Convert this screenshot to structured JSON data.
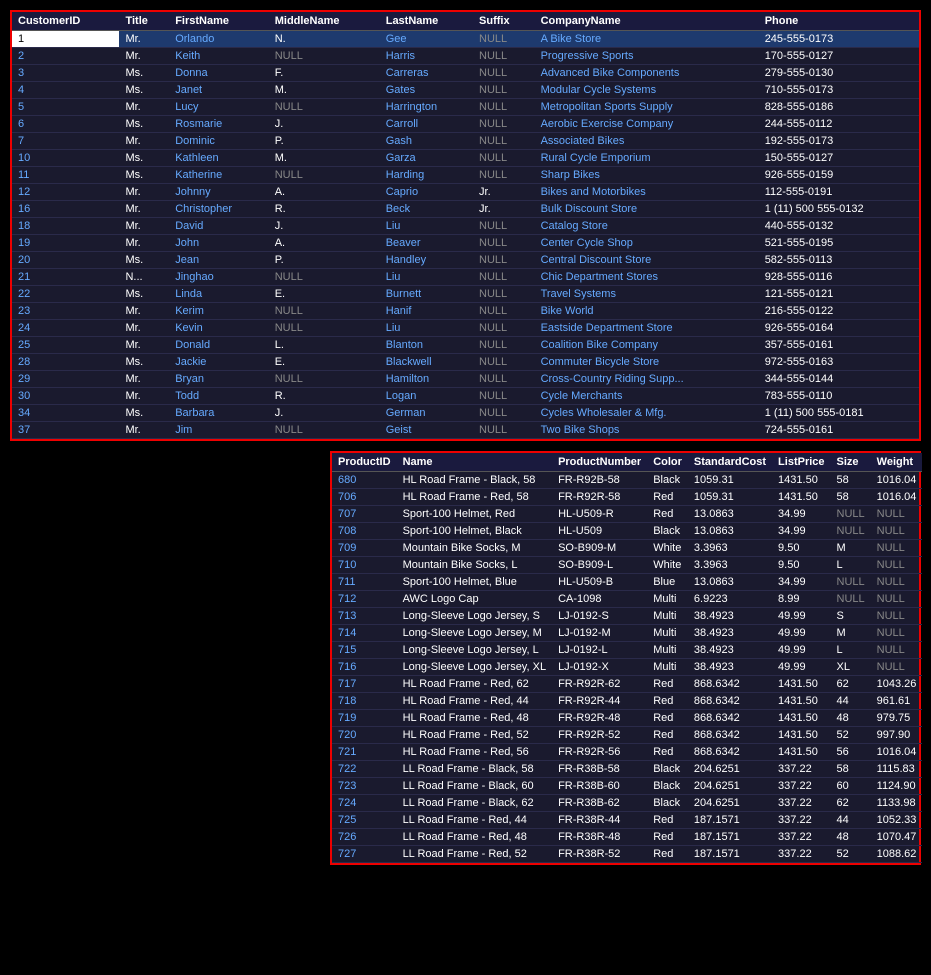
{
  "table1": {
    "columns": [
      "CustomerID",
      "Title",
      "FirstName",
      "MiddleName",
      "LastName",
      "Suffix",
      "CompanyName",
      "Phone"
    ],
    "rows": [
      {
        "id": "1",
        "title": "Mr.",
        "firstName": "Orlando",
        "middleName": "N.",
        "lastName": "Gee",
        "suffix": "NULL",
        "company": "A Bike Store",
        "phone": "245-555-0173",
        "selected": true
      },
      {
        "id": "2",
        "title": "Mr.",
        "firstName": "Keith",
        "middleName": "NULL",
        "lastName": "Harris",
        "suffix": "NULL",
        "company": "Progressive Sports",
        "phone": "170-555-0127"
      },
      {
        "id": "3",
        "title": "Ms.",
        "firstName": "Donna",
        "middleName": "F.",
        "lastName": "Carreras",
        "suffix": "NULL",
        "company": "Advanced Bike Components",
        "phone": "279-555-0130"
      },
      {
        "id": "4",
        "title": "Ms.",
        "firstName": "Janet",
        "middleName": "M.",
        "lastName": "Gates",
        "suffix": "NULL",
        "company": "Modular Cycle Systems",
        "phone": "710-555-0173"
      },
      {
        "id": "5",
        "title": "Mr.",
        "firstName": "Lucy",
        "middleName": "NULL",
        "lastName": "Harrington",
        "suffix": "NULL",
        "company": "Metropolitan Sports Supply",
        "phone": "828-555-0186"
      },
      {
        "id": "6",
        "title": "Ms.",
        "firstName": "Rosmarie",
        "middleName": "J.",
        "lastName": "Carroll",
        "suffix": "NULL",
        "company": "Aerobic Exercise Company",
        "phone": "244-555-0112"
      },
      {
        "id": "7",
        "title": "Mr.",
        "firstName": "Dominic",
        "middleName": "P.",
        "lastName": "Gash",
        "suffix": "NULL",
        "company": "Associated Bikes",
        "phone": "192-555-0173"
      },
      {
        "id": "10",
        "title": "Ms.",
        "firstName": "Kathleen",
        "middleName": "M.",
        "lastName": "Garza",
        "suffix": "NULL",
        "company": "Rural Cycle Emporium",
        "phone": "150-555-0127"
      },
      {
        "id": "11",
        "title": "Ms.",
        "firstName": "Katherine",
        "middleName": "NULL",
        "lastName": "Harding",
        "suffix": "NULL",
        "company": "Sharp Bikes",
        "phone": "926-555-0159"
      },
      {
        "id": "12",
        "title": "Mr.",
        "firstName": "Johnny",
        "middleName": "A.",
        "lastName": "Caprio",
        "suffix": "Jr.",
        "company": "Bikes and Motorbikes",
        "phone": "112-555-0191"
      },
      {
        "id": "16",
        "title": "Mr.",
        "firstName": "Christopher",
        "middleName": "R.",
        "lastName": "Beck",
        "suffix": "Jr.",
        "company": "Bulk Discount Store",
        "phone": "1 (11) 500 555-0132"
      },
      {
        "id": "18",
        "title": "Mr.",
        "firstName": "David",
        "middleName": "J.",
        "lastName": "Liu",
        "suffix": "NULL",
        "company": "Catalog Store",
        "phone": "440-555-0132"
      },
      {
        "id": "19",
        "title": "Mr.",
        "firstName": "John",
        "middleName": "A.",
        "lastName": "Beaver",
        "suffix": "NULL",
        "company": "Center Cycle Shop",
        "phone": "521-555-0195"
      },
      {
        "id": "20",
        "title": "Ms.",
        "firstName": "Jean",
        "middleName": "P.",
        "lastName": "Handley",
        "suffix": "NULL",
        "company": "Central Discount Store",
        "phone": "582-555-0113"
      },
      {
        "id": "21",
        "title": "N...",
        "firstName": "Jinghao",
        "middleName": "NULL",
        "lastName": "Liu",
        "suffix": "NULL",
        "company": "Chic Department Stores",
        "phone": "928-555-0116"
      },
      {
        "id": "22",
        "title": "Ms.",
        "firstName": "Linda",
        "middleName": "E.",
        "lastName": "Burnett",
        "suffix": "NULL",
        "company": "Travel Systems",
        "phone": "121-555-0121"
      },
      {
        "id": "23",
        "title": "Mr.",
        "firstName": "Kerim",
        "middleName": "NULL",
        "lastName": "Hanif",
        "suffix": "NULL",
        "company": "Bike World",
        "phone": "216-555-0122"
      },
      {
        "id": "24",
        "title": "Mr.",
        "firstName": "Kevin",
        "middleName": "NULL",
        "lastName": "Liu",
        "suffix": "NULL",
        "company": "Eastside Department Store",
        "phone": "926-555-0164"
      },
      {
        "id": "25",
        "title": "Mr.",
        "firstName": "Donald",
        "middleName": "L.",
        "lastName": "Blanton",
        "suffix": "NULL",
        "company": "Coalition Bike Company",
        "phone": "357-555-0161"
      },
      {
        "id": "28",
        "title": "Ms.",
        "firstName": "Jackie",
        "middleName": "E.",
        "lastName": "Blackwell",
        "suffix": "NULL",
        "company": "Commuter Bicycle Store",
        "phone": "972-555-0163"
      },
      {
        "id": "29",
        "title": "Mr.",
        "firstName": "Bryan",
        "middleName": "NULL",
        "lastName": "Hamilton",
        "suffix": "NULL",
        "company": "Cross-Country Riding Supp...",
        "phone": "344-555-0144"
      },
      {
        "id": "30",
        "title": "Mr.",
        "firstName": "Todd",
        "middleName": "R.",
        "lastName": "Logan",
        "suffix": "NULL",
        "company": "Cycle Merchants",
        "phone": "783-555-0110"
      },
      {
        "id": "34",
        "title": "Ms.",
        "firstName": "Barbara",
        "middleName": "J.",
        "lastName": "German",
        "suffix": "NULL",
        "company": "Cycles Wholesaler & Mfg.",
        "phone": "1 (11) 500 555-0181"
      },
      {
        "id": "37",
        "title": "Mr.",
        "firstName": "Jim",
        "middleName": "NULL",
        "lastName": "Geist",
        "suffix": "NULL",
        "company": "Two Bike Shops",
        "phone": "724-555-0161"
      }
    ]
  },
  "table2": {
    "columns": [
      "ProductID",
      "Name",
      "ProductNumber",
      "Color",
      "StandardCost",
      "ListPrice",
      "Size",
      "Weight"
    ],
    "rows": [
      {
        "id": "680",
        "name": "HL Road Frame - Black, 58",
        "productNumber": "FR-R92B-58",
        "color": "Black",
        "standardCost": "1059.31",
        "listPrice": "1431.50",
        "size": "58",
        "weight": "1016.04"
      },
      {
        "id": "706",
        "name": "HL Road Frame - Red, 58",
        "productNumber": "FR-R92R-58",
        "color": "Red",
        "standardCost": "1059.31",
        "listPrice": "1431.50",
        "size": "58",
        "weight": "1016.04"
      },
      {
        "id": "707",
        "name": "Sport-100 Helmet, Red",
        "productNumber": "HL-U509-R",
        "color": "Red",
        "standardCost": "13.0863",
        "listPrice": "34.99",
        "size": "NULL",
        "weight": "NULL"
      },
      {
        "id": "708",
        "name": "Sport-100 Helmet, Black",
        "productNumber": "HL-U509",
        "color": "Black",
        "standardCost": "13.0863",
        "listPrice": "34.99",
        "size": "NULL",
        "weight": "NULL"
      },
      {
        "id": "709",
        "name": "Mountain Bike Socks, M",
        "productNumber": "SO-B909-M",
        "color": "White",
        "standardCost": "3.3963",
        "listPrice": "9.50",
        "size": "M",
        "weight": "NULL"
      },
      {
        "id": "710",
        "name": "Mountain Bike Socks, L",
        "productNumber": "SO-B909-L",
        "color": "White",
        "standardCost": "3.3963",
        "listPrice": "9.50",
        "size": "L",
        "weight": "NULL"
      },
      {
        "id": "711",
        "name": "Sport-100 Helmet, Blue",
        "productNumber": "HL-U509-B",
        "color": "Blue",
        "standardCost": "13.0863",
        "listPrice": "34.99",
        "size": "NULL",
        "weight": "NULL"
      },
      {
        "id": "712",
        "name": "AWC Logo Cap",
        "productNumber": "CA-1098",
        "color": "Multi",
        "standardCost": "6.9223",
        "listPrice": "8.99",
        "size": "NULL",
        "weight": "NULL"
      },
      {
        "id": "713",
        "name": "Long-Sleeve Logo Jersey, S",
        "productNumber": "LJ-0192-S",
        "color": "Multi",
        "standardCost": "38.4923",
        "listPrice": "49.99",
        "size": "S",
        "weight": "NULL"
      },
      {
        "id": "714",
        "name": "Long-Sleeve Logo Jersey, M",
        "productNumber": "LJ-0192-M",
        "color": "Multi",
        "standardCost": "38.4923",
        "listPrice": "49.99",
        "size": "M",
        "weight": "NULL"
      },
      {
        "id": "715",
        "name": "Long-Sleeve Logo Jersey, L",
        "productNumber": "LJ-0192-L",
        "color": "Multi",
        "standardCost": "38.4923",
        "listPrice": "49.99",
        "size": "L",
        "weight": "NULL"
      },
      {
        "id": "716",
        "name": "Long-Sleeve Logo Jersey, XL",
        "productNumber": "LJ-0192-X",
        "color": "Multi",
        "standardCost": "38.4923",
        "listPrice": "49.99",
        "size": "XL",
        "weight": "NULL"
      },
      {
        "id": "717",
        "name": "HL Road Frame - Red, 62",
        "productNumber": "FR-R92R-62",
        "color": "Red",
        "standardCost": "868.6342",
        "listPrice": "1431.50",
        "size": "62",
        "weight": "1043.26"
      },
      {
        "id": "718",
        "name": "HL Road Frame - Red, 44",
        "productNumber": "FR-R92R-44",
        "color": "Red",
        "standardCost": "868.6342",
        "listPrice": "1431.50",
        "size": "44",
        "weight": "961.61"
      },
      {
        "id": "719",
        "name": "HL Road Frame - Red, 48",
        "productNumber": "FR-R92R-48",
        "color": "Red",
        "standardCost": "868.6342",
        "listPrice": "1431.50",
        "size": "48",
        "weight": "979.75"
      },
      {
        "id": "720",
        "name": "HL Road Frame - Red, 52",
        "productNumber": "FR-R92R-52",
        "color": "Red",
        "standardCost": "868.6342",
        "listPrice": "1431.50",
        "size": "52",
        "weight": "997.90"
      },
      {
        "id": "721",
        "name": "HL Road Frame - Red, 56",
        "productNumber": "FR-R92R-56",
        "color": "Red",
        "standardCost": "868.6342",
        "listPrice": "1431.50",
        "size": "56",
        "weight": "1016.04"
      },
      {
        "id": "722",
        "name": "LL Road Frame - Black, 58",
        "productNumber": "FR-R38B-58",
        "color": "Black",
        "standardCost": "204.6251",
        "listPrice": "337.22",
        "size": "58",
        "weight": "1115.83"
      },
      {
        "id": "723",
        "name": "LL Road Frame - Black, 60",
        "productNumber": "FR-R38B-60",
        "color": "Black",
        "standardCost": "204.6251",
        "listPrice": "337.22",
        "size": "60",
        "weight": "1124.90"
      },
      {
        "id": "724",
        "name": "LL Road Frame - Black, 62",
        "productNumber": "FR-R38B-62",
        "color": "Black",
        "standardCost": "204.6251",
        "listPrice": "337.22",
        "size": "62",
        "weight": "1133.98"
      },
      {
        "id": "725",
        "name": "LL Road Frame - Red, 44",
        "productNumber": "FR-R38R-44",
        "color": "Red",
        "standardCost": "187.1571",
        "listPrice": "337.22",
        "size": "44",
        "weight": "1052.33"
      },
      {
        "id": "726",
        "name": "LL Road Frame - Red, 48",
        "productNumber": "FR-R38R-48",
        "color": "Red",
        "standardCost": "187.1571",
        "listPrice": "337.22",
        "size": "48",
        "weight": "1070.47"
      },
      {
        "id": "727",
        "name": "LL Road Frame - Red, 52",
        "productNumber": "FR-R38R-52",
        "color": "Red",
        "standardCost": "187.1571",
        "listPrice": "337.22",
        "size": "52",
        "weight": "1088.62"
      }
    ]
  }
}
